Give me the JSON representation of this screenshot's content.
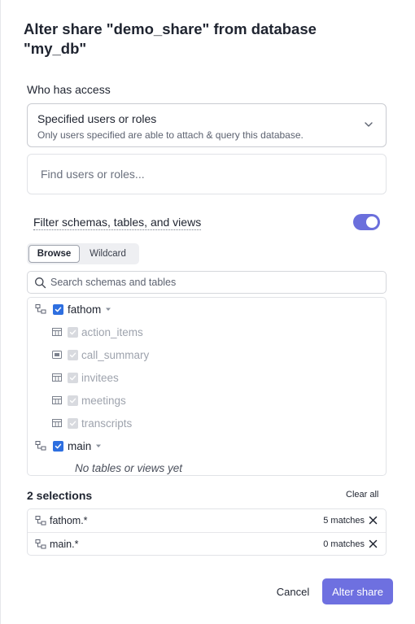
{
  "dialog": {
    "title": "Alter share \"demo_share\" from database \"my_db\""
  },
  "access": {
    "label": "Who has access",
    "selected_option": "Specified users or roles",
    "selected_description": "Only users specified are able to attach & query this database.",
    "find_placeholder": "Find users or roles..."
  },
  "filter": {
    "label": "Filter schemas, tables, and views",
    "enabled": true,
    "modes": [
      {
        "label": "Browse",
        "active": true
      },
      {
        "label": "Wildcard",
        "active": false
      }
    ],
    "search_placeholder": "Search schemas and tables"
  },
  "tree": {
    "schemas": [
      {
        "name": "fathom",
        "checked": true,
        "tables": [
          {
            "name": "action_items",
            "icon": "table-icon"
          },
          {
            "name": "call_summary",
            "icon": "view-icon"
          },
          {
            "name": "invitees",
            "icon": "table-icon"
          },
          {
            "name": "meetings",
            "icon": "table-icon"
          },
          {
            "name": "transcripts",
            "icon": "table-icon"
          }
        ]
      },
      {
        "name": "main",
        "checked": true,
        "empty_text": "No tables or views yet"
      }
    ]
  },
  "selections": {
    "title": "2 selections",
    "clear_label": "Clear all",
    "items": [
      {
        "name": "fathom.*",
        "matches": "5 matches"
      },
      {
        "name": "main.*",
        "matches": "0 matches"
      }
    ]
  },
  "footer": {
    "cancel_label": "Cancel",
    "submit_label": "Alter share"
  },
  "colors": {
    "primary": "#6e70e0",
    "checkbox": "#2e6fe0",
    "toggle": "#6b6fdc"
  }
}
